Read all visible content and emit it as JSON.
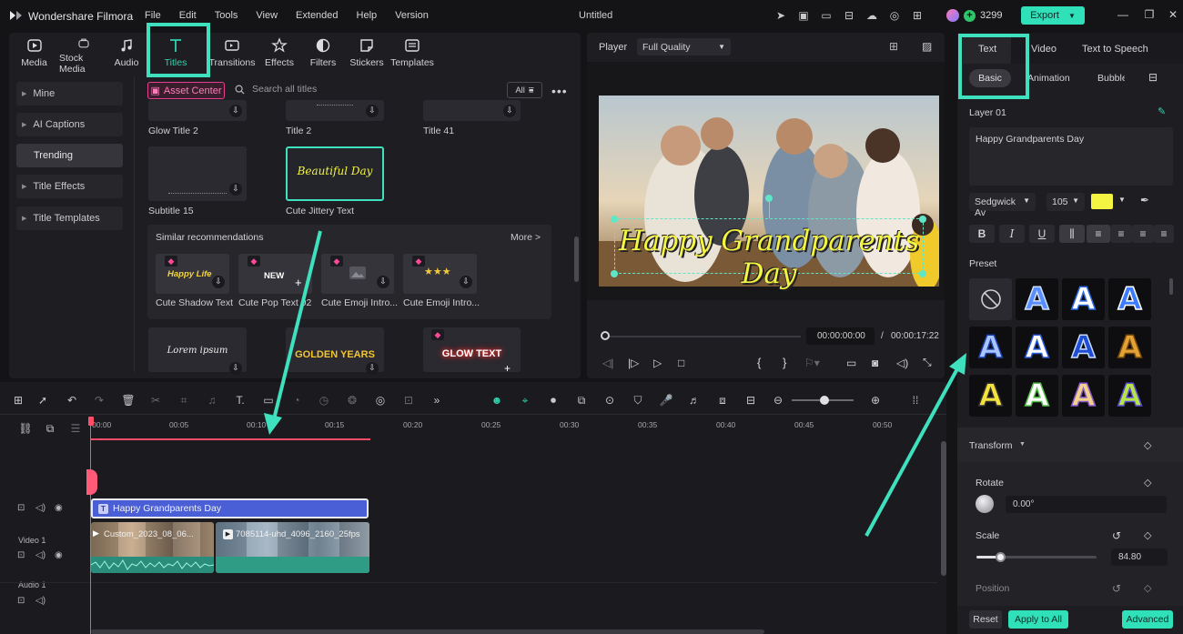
{
  "app": {
    "name": "Wondershare Filmora",
    "menu": [
      "File",
      "Edit",
      "Tools",
      "View",
      "Extended",
      "Help",
      "Version"
    ],
    "document_title": "Untitled",
    "credits": "3299",
    "export_label": "Export"
  },
  "media_tabs": [
    "Media",
    "Stock Media",
    "Audio",
    "Titles",
    "Transitions",
    "Effects",
    "Filters",
    "Stickers",
    "Templates"
  ],
  "sidebar": [
    "Mine",
    "AI Captions",
    "Trending",
    "Title Effects",
    "Title Templates"
  ],
  "library": {
    "asset_center": "Asset Center",
    "search_placeholder": "Search all titles",
    "filter_label": "All",
    "row1": [
      "Glow Title 2",
      "Title 2",
      "Title 41"
    ],
    "row2": [
      "Subtitle 15",
      "Cute Jittery Text"
    ],
    "selected_preview_text": "Beautiful Day",
    "similar_title": "Similar recommendations",
    "similar_more": "More >",
    "similar_items": [
      "Cute Shadow Text",
      "Cute Pop Text 02",
      "Cute Emoji Intro...",
      "Cute Emoji Intro..."
    ],
    "similar_thumb_texts": [
      "Happy Life",
      "NEW"
    ],
    "row3_texts": [
      "Lorem ipsum",
      "GOLDEN YEARS",
      "GLOW TEXT"
    ]
  },
  "player": {
    "label": "Player",
    "quality": "Full Quality",
    "overlay_text": "Happy Grandparents Day",
    "current_time": "00:00:00:00",
    "separator": "/",
    "total_time": "00:00:17:22"
  },
  "right_panel": {
    "tabs": [
      "Text",
      "Video",
      "Text to Speech"
    ],
    "subtabs": [
      "Basic",
      "Animation",
      "Bubble"
    ],
    "layer": "Layer 01",
    "text_value": "Happy Grandparents Day",
    "font": "Sedgwick Av",
    "font_size": "105",
    "font_color": "#f4f442",
    "format_buttons": [
      "B",
      "I",
      "U"
    ],
    "preset_label": "Preset",
    "preset_glyph": "A",
    "transform_label": "Transform",
    "rotate_label": "Rotate",
    "rotate_value": "0.00°",
    "scale_label": "Scale",
    "scale_value": "84.80",
    "scale_fraction": 0.2,
    "position_label": "Position",
    "reset_label": "Reset",
    "apply_label": "Apply to All",
    "advanced_label": "Advanced"
  },
  "timeline": {
    "ticks": [
      "00:00",
      "00:05",
      "00:10",
      "00:15",
      "00:20",
      "00:25",
      "00:30",
      "00:35",
      "00:40",
      "00:45",
      "00:50"
    ],
    "title_clip": "Happy Grandparents Day",
    "video_clip_1": "Custom_2023_08_06...",
    "video_clip_2": "7085114-uhd_4096_2160_25fps",
    "track_video": "Video 1",
    "track_audio": "Audio 1"
  },
  "colors": {
    "accent": "#31d3b0",
    "highlight": "#3ee0bd",
    "export_bg": "#2fe0b8",
    "asset_pink": "#e3408f",
    "title_clip": "#4a5fd6",
    "playhead": "#ff4d6a"
  }
}
